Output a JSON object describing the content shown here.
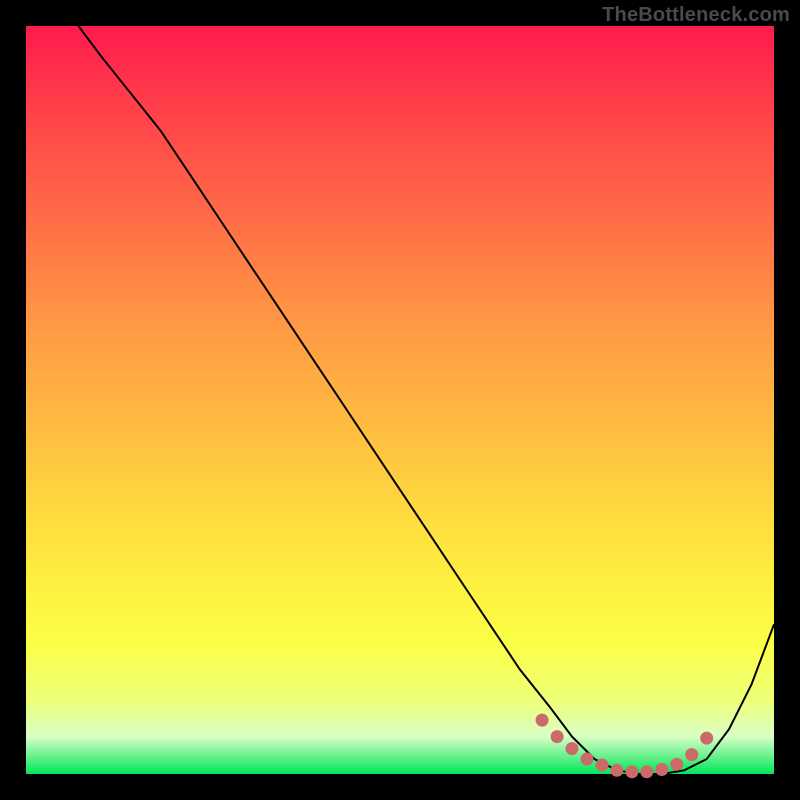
{
  "watermark": "TheBottleneck.com",
  "colors": {
    "frame": "#000000",
    "curve": "#000000",
    "dots": "#cc6a6a",
    "dot_stroke": "#b95a5a",
    "gradient_top": "#ff1a4d",
    "gradient_bottom": "#00e55a"
  },
  "chart_data": {
    "type": "line",
    "title": "",
    "xlabel": "",
    "ylabel": "",
    "xlim": [
      0,
      100
    ],
    "ylim": [
      0,
      100
    ],
    "x": [
      7,
      10,
      14,
      18,
      22,
      26,
      30,
      34,
      38,
      42,
      46,
      50,
      54,
      58,
      62,
      66,
      70,
      73,
      76,
      79,
      82,
      85,
      88,
      91,
      94,
      97,
      100
    ],
    "values": [
      100,
      96,
      91,
      86,
      80,
      74,
      68,
      62,
      56,
      50,
      44,
      38,
      32,
      26,
      20,
      14,
      9,
      5,
      2,
      0.5,
      0,
      0,
      0.5,
      2,
      6,
      12,
      20
    ],
    "valley_dots_x": [
      69,
      71,
      73,
      75,
      77,
      79,
      81,
      83,
      85,
      87,
      89,
      91
    ],
    "valley_dots_y": [
      7.2,
      5.0,
      3.4,
      2.0,
      1.2,
      0.5,
      0.3,
      0.3,
      0.6,
      1.3,
      2.6,
      4.8
    ]
  }
}
